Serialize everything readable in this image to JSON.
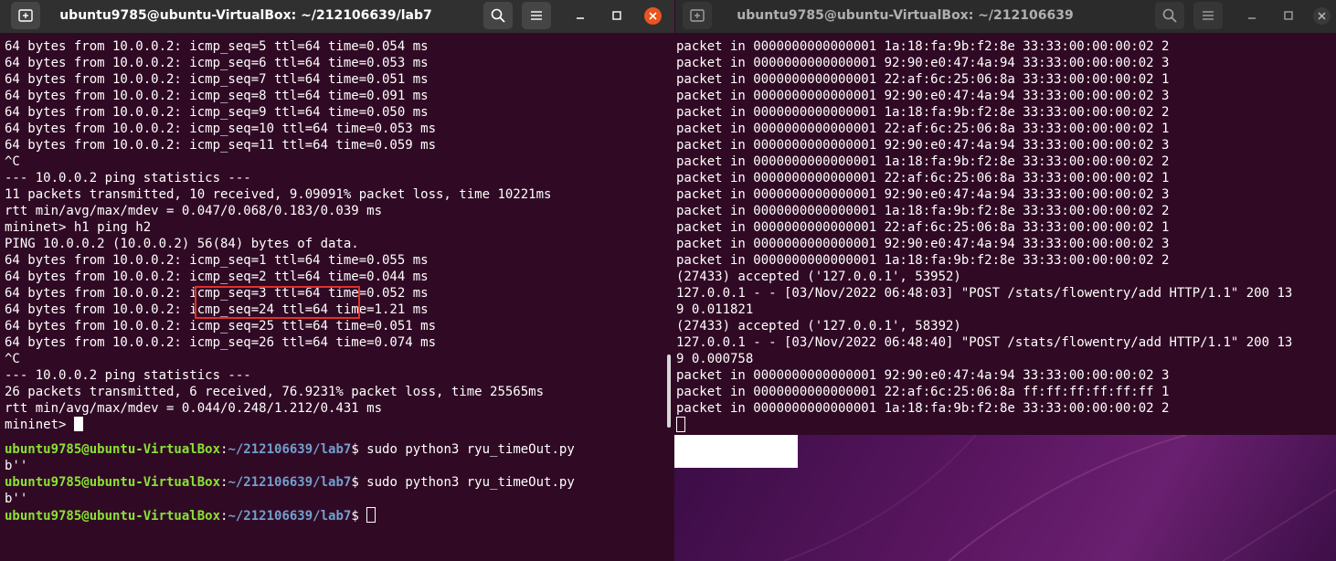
{
  "left_window": {
    "title": "ubuntu9785@ubuntu-VirtualBox: ~/212106639/lab7",
    "lines": [
      "64 bytes from 10.0.0.2: icmp_seq=5 ttl=64 time=0.054 ms",
      "64 bytes from 10.0.0.2: icmp_seq=6 ttl=64 time=0.053 ms",
      "64 bytes from 10.0.0.2: icmp_seq=7 ttl=64 time=0.051 ms",
      "64 bytes from 10.0.0.2: icmp_seq=8 ttl=64 time=0.091 ms",
      "64 bytes from 10.0.0.2: icmp_seq=9 ttl=64 time=0.050 ms",
      "64 bytes from 10.0.0.2: icmp_seq=10 ttl=64 time=0.053 ms",
      "64 bytes from 10.0.0.2: icmp_seq=11 ttl=64 time=0.059 ms",
      "^C",
      "--- 10.0.0.2 ping statistics ---",
      "11 packets transmitted, 10 received, 9.09091% packet loss, time 10221ms",
      "rtt min/avg/max/mdev = 0.047/0.068/0.183/0.039 ms",
      "mininet> h1 ping h2",
      "PING 10.0.0.2 (10.0.0.2) 56(84) bytes of data.",
      "64 bytes from 10.0.0.2: icmp_seq=1 ttl=64 time=0.055 ms",
      "64 bytes from 10.0.0.2: icmp_seq=2 ttl=64 time=0.044 ms",
      "64 bytes from 10.0.0.2: icmp_seq=3 ttl=64 time=0.052 ms",
      "64 bytes from 10.0.0.2: icmp_seq=24 ttl=64 time=1.21 ms",
      "64 bytes from 10.0.0.2: icmp_seq=25 ttl=64 time=0.051 ms",
      "64 bytes from 10.0.0.2: icmp_seq=26 ttl=64 time=0.074 ms",
      "^C",
      "--- 10.0.0.2 ping statistics ---",
      "26 packets transmitted, 6 received, 76.9231% packet loss, time 25565ms",
      "rtt min/avg/max/mdev = 0.044/0.248/1.212/0.431 ms"
    ],
    "prompt": "mininet> "
  },
  "bottom_window": {
    "user_host": "ubuntu9785@ubuntu-VirtualBox",
    "colon": ":",
    "path": "~/212106639/lab7",
    "dollar": "$",
    "command": " sudo python3 ryu_timeOut.py",
    "output": "b''"
  },
  "right_window": {
    "title": "ubuntu9785@ubuntu-VirtualBox: ~/212106639",
    "lines": [
      "packet in 0000000000000001 1a:18:fa:9b:f2:8e 33:33:00:00:00:02 2",
      "packet in 0000000000000001 92:90:e0:47:4a:94 33:33:00:00:00:02 3",
      "packet in 0000000000000001 22:af:6c:25:06:8a 33:33:00:00:00:02 1",
      "packet in 0000000000000001 92:90:e0:47:4a:94 33:33:00:00:00:02 3",
      "packet in 0000000000000001 1a:18:fa:9b:f2:8e 33:33:00:00:00:02 2",
      "packet in 0000000000000001 22:af:6c:25:06:8a 33:33:00:00:00:02 1",
      "packet in 0000000000000001 92:90:e0:47:4a:94 33:33:00:00:00:02 3",
      "packet in 0000000000000001 1a:18:fa:9b:f2:8e 33:33:00:00:00:02 2",
      "packet in 0000000000000001 22:af:6c:25:06:8a 33:33:00:00:00:02 1",
      "packet in 0000000000000001 92:90:e0:47:4a:94 33:33:00:00:00:02 3",
      "packet in 0000000000000001 1a:18:fa:9b:f2:8e 33:33:00:00:00:02 2",
      "packet in 0000000000000001 22:af:6c:25:06:8a 33:33:00:00:00:02 1",
      "packet in 0000000000000001 92:90:e0:47:4a:94 33:33:00:00:00:02 3",
      "packet in 0000000000000001 1a:18:fa:9b:f2:8e 33:33:00:00:00:02 2",
      "(27433) accepted ('127.0.0.1', 53952)",
      "127.0.0.1 - - [03/Nov/2022 06:48:03] \"POST /stats/flowentry/add HTTP/1.1\" 200 13",
      "9 0.011821",
      "(27433) accepted ('127.0.0.1', 58392)",
      "127.0.0.1 - - [03/Nov/2022 06:48:40] \"POST /stats/flowentry/add HTTP/1.1\" 200 13",
      "9 0.000758",
      "packet in 0000000000000001 92:90:e0:47:4a:94 33:33:00:00:00:02 3",
      "packet in 0000000000000001 22:af:6c:25:06:8a ff:ff:ff:ff:ff:ff 1",
      "packet in 0000000000000001 1a:18:fa:9b:f2:8e 33:33:00:00:00:02 2"
    ]
  },
  "icons": {
    "new_tab": "new-tab-icon",
    "search": "search-icon",
    "menu": "hamburger-menu-icon",
    "minimize": "minimize-icon",
    "maximize": "maximize-icon",
    "close": "close-icon"
  },
  "colors": {
    "terminal_bg": "#300a24",
    "titlebar_bg": "#303030",
    "user_host": "#8ae234",
    "path": "#729fcf",
    "highlight_box": "#e0302a",
    "close_active": "#e95420"
  }
}
